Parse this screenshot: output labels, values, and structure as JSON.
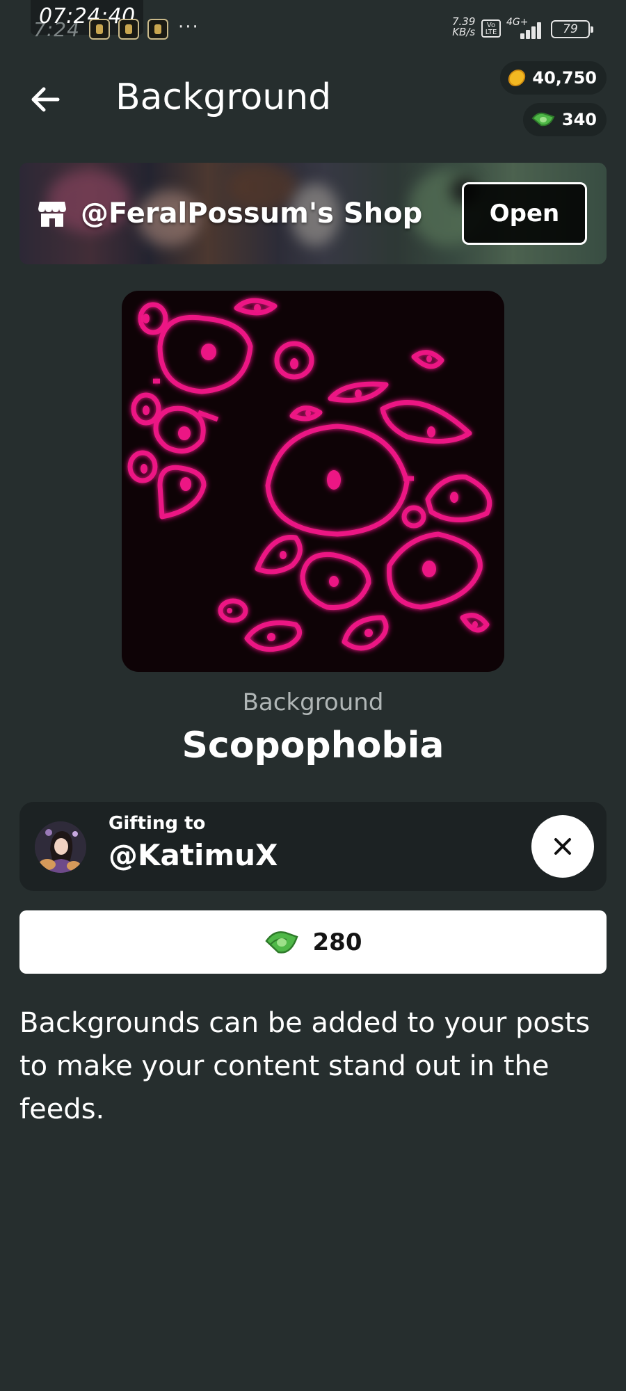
{
  "status_bar": {
    "clock": "07:24:40",
    "clock_ghost": "7:24",
    "more": "···",
    "speed_value": "7.39",
    "speed_unit": "KB/s",
    "volte": "Vo LTE",
    "network": "4G+",
    "battery": "79"
  },
  "header": {
    "title": "Background",
    "back_icon": "arrow-left-icon"
  },
  "balances": {
    "coins": "40,750",
    "cash": "340",
    "coin_icon": "gold-coin-icon",
    "cash_icon": "green-cash-icon"
  },
  "shop": {
    "name": "@FeralPossum's Shop",
    "open_label": "Open",
    "icon": "storefront-icon"
  },
  "item": {
    "category": "Background",
    "name": "Scopophobia",
    "accent_color": "#e8107a"
  },
  "gift": {
    "label": "Gifting to",
    "username": "@KatimuX",
    "close_icon": "close-icon"
  },
  "purchase": {
    "price": "280",
    "currency_icon": "green-cash-icon"
  },
  "description": "Backgrounds can be added to your posts to make your content stand out in the feeds."
}
